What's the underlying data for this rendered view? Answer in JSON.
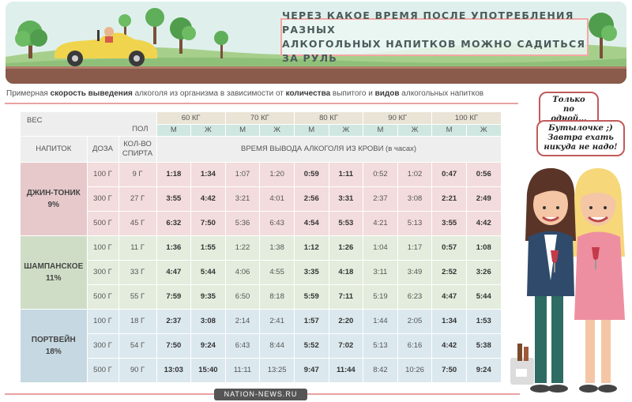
{
  "header": {
    "title_line1": "ЧЕРЕЗ КАКОЕ ВРЕМЯ ПОСЛЕ УПОТРЕБЛЕНИЯ РАЗНЫХ",
    "title_line2": "АЛКОГОЛЬНЫХ НАПИТКОВ МОЖНО САДИТЬСЯ ЗА РУЛЬ"
  },
  "subtitle": {
    "p1": "Примерная ",
    "b1": "скорость выведения",
    "p2": " алкоголя из организма в зависимости от ",
    "b2": "количества",
    "p3": " выпитого и ",
    "b3": "видов",
    "p4": " алкогольных напитков"
  },
  "table": {
    "weight_label": "ВЕС",
    "sex_label": "ПОЛ",
    "drink_label": "НАПИТОК",
    "dose_label": "ДОЗА",
    "spirit_label_1": "КОЛ-ВО",
    "spirit_label_2": "СПИРТА",
    "time_label": "ВРЕМЯ ВЫВОДА АЛКОГОЛЯ ИЗ КРОВИ (в часах)",
    "weights": [
      "60 КГ",
      "70 КГ",
      "80 КГ",
      "90 КГ",
      "100 КГ"
    ],
    "male": "М",
    "female": "Ж",
    "groups": [
      {
        "name": "ДЖИН-ТОНИК",
        "percent": "9%",
        "rows": [
          {
            "dose": "100 Г",
            "spirit": "9 Г",
            "times": [
              "1:18",
              "1:34",
              "1:07",
              "1:20",
              "0:59",
              "1:11",
              "0:52",
              "1:02",
              "0:47",
              "0:56"
            ]
          },
          {
            "dose": "300 Г",
            "spirit": "27 Г",
            "times": [
              "3:55",
              "4:42",
              "3:21",
              "4:01",
              "2:56",
              "3:31",
              "2:37",
              "3:08",
              "2:21",
              "2:49"
            ]
          },
          {
            "dose": "500 Г",
            "spirit": "45 Г",
            "times": [
              "6:32",
              "7:50",
              "5:36",
              "6:43",
              "4:54",
              "5:53",
              "4:21",
              "5:13",
              "3:55",
              "4:42"
            ]
          }
        ]
      },
      {
        "name": "ШАМПАНСКОЕ",
        "percent": "11%",
        "rows": [
          {
            "dose": "100 Г",
            "spirit": "11 Г",
            "times": [
              "1:36",
              "1:55",
              "1:22",
              "1:38",
              "1:12",
              "1:26",
              "1:04",
              "1:17",
              "0:57",
              "1:08"
            ]
          },
          {
            "dose": "300 Г",
            "spirit": "33 Г",
            "times": [
              "4:47",
              "5:44",
              "4:06",
              "4:55",
              "3:35",
              "4:18",
              "3:11",
              "3:49",
              "2:52",
              "3:26"
            ]
          },
          {
            "dose": "500 Г",
            "spirit": "55 Г",
            "times": [
              "7:59",
              "9:35",
              "6:50",
              "8:18",
              "5:59",
              "7:11",
              "5:19",
              "6:23",
              "4:47",
              "5:44"
            ]
          }
        ]
      },
      {
        "name": "ПОРТВЕЙН",
        "percent": "18%",
        "rows": [
          {
            "dose": "100 Г",
            "spirit": "18 Г",
            "times": [
              "2:37",
              "3:08",
              "2:14",
              "2:41",
              "1:57",
              "2:20",
              "1:44",
              "2:05",
              "1:34",
              "1:53"
            ]
          },
          {
            "dose": "300 Г",
            "spirit": "54 Г",
            "times": [
              "7:50",
              "9:24",
              "6:43",
              "8:44",
              "5:52",
              "7:02",
              "5:13",
              "6:16",
              "4:42",
              "5:38"
            ]
          },
          {
            "dose": "500 Г",
            "spirit": "90 Г",
            "times": [
              "13:03",
              "15:40",
              "11:11",
              "13:25",
              "9:47",
              "11:44",
              "8:42",
              "10:26",
              "7:50",
              "9:24"
            ]
          }
        ]
      }
    ]
  },
  "bubbles": {
    "one_line1": "Только",
    "one_line2": "по одной...",
    "two_line1": "Бутылочке ;)",
    "two_line2": "Завтра ехать",
    "two_line3": "никуда не надо!"
  },
  "footer": {
    "site": "NATION-NEWS.RU"
  },
  "colors": {
    "accent_pink": "#e8a2a2",
    "gin_row": "#f3dcdd",
    "champagne_row": "#e3ecdd",
    "port_row": "#dbe8ee",
    "weight_header": "#e9e4d6",
    "sex_header": "#cfe7e0"
  }
}
